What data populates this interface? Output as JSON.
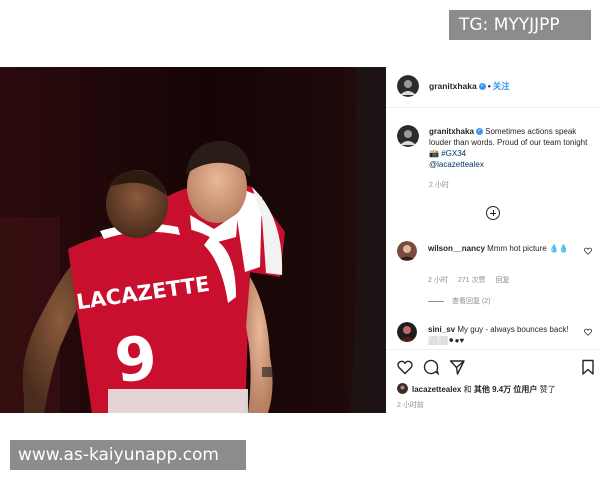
{
  "watermarks": {
    "top_right": "TG: MYYJJPP",
    "bottom_left": "www.as-kaiyunapp.com"
  },
  "post": {
    "photo": {
      "alt_icon": "football-players-celebrating-image",
      "jersey_name": "LACAZETTE",
      "jersey_number": "9"
    },
    "header": {
      "username": "granitxhaka",
      "separator": "•",
      "follow_label": "关注"
    },
    "caption": {
      "username": "granitxhaka",
      "text": "Sometimes actions speak louder than words. Proud of our team tonight 📸",
      "hashtag": "#GX34",
      "mention": "@lacazettealex",
      "time": "2 小时"
    },
    "comments": [
      {
        "username": "wilson__nancy",
        "text": "Mmm hot picture 💧💧",
        "time": "2 小时",
        "likes": "271 次赞",
        "reply_label": "回复",
        "view_replies": "查看回复 (2)"
      },
      {
        "username": "sini_sv",
        "text": "My guy - always bounces back! ⬜⬜⚫●♥"
      }
    ],
    "liked_by": {
      "user": "lacazettealex",
      "and": "和",
      "others": "其他 9.4万 位用户",
      "suffix": "赞了"
    },
    "post_time": "2 小时前"
  },
  "colors": {
    "arsenal_red": "#c8102e",
    "link_blue": "#3897f0",
    "muted_text": "#8e8e8e"
  }
}
